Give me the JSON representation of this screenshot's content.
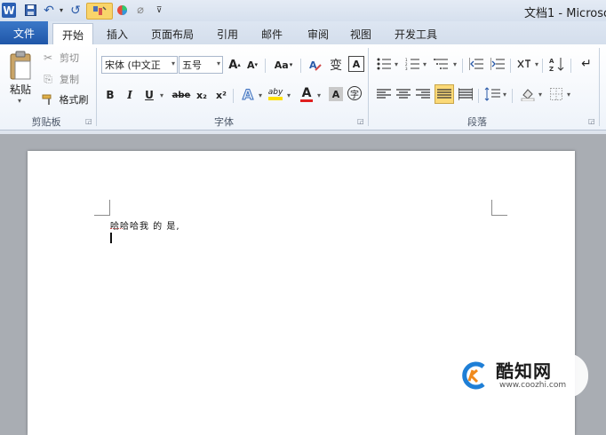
{
  "window": {
    "title": "文档1 - Microso"
  },
  "quick_access": {
    "word_icon": "W",
    "save_icon": "save-icon",
    "undo_icon": "undo-icon",
    "redo_icon": "redo-icon"
  },
  "tabs": {
    "file": "文件",
    "home": "开始",
    "insert": "插入",
    "page_layout": "页面布局",
    "references": "引用",
    "mailings": "邮件",
    "review": "审阅",
    "view": "视图",
    "developer": "开发工具"
  },
  "clipboard": {
    "paste": "粘贴",
    "cut": "剪切",
    "copy": "复制",
    "format_painter": "格式刷",
    "group_label": "剪贴板"
  },
  "font": {
    "font_name": "宋体 (中文正",
    "font_size": "五号",
    "grow": "A",
    "shrink": "A",
    "change_case": "Aa",
    "clear": "A",
    "bold": "B",
    "italic": "I",
    "underline": "U",
    "strike": "abe",
    "subscript": "x₂",
    "superscript": "x²",
    "effects": "A",
    "highlight": "aby",
    "font_color": "A",
    "shading": "A",
    "enclose": "字",
    "group_label": "字体"
  },
  "paragraph": {
    "group_label": "段落"
  },
  "document": {
    "line1": "哈哈哈我 的 是,"
  },
  "watermark": {
    "brand": "酷知网",
    "url": "www.coozhi.com"
  },
  "colors": {
    "file_tab": "#2a63b5",
    "ribbon_bg": "#ffffff",
    "workspace": "#a9adb3",
    "highlight_yellow": "#ffe000",
    "font_red": "#e02020",
    "watermark_blue": "#1f7fd6",
    "watermark_orange": "#f08a1c"
  }
}
